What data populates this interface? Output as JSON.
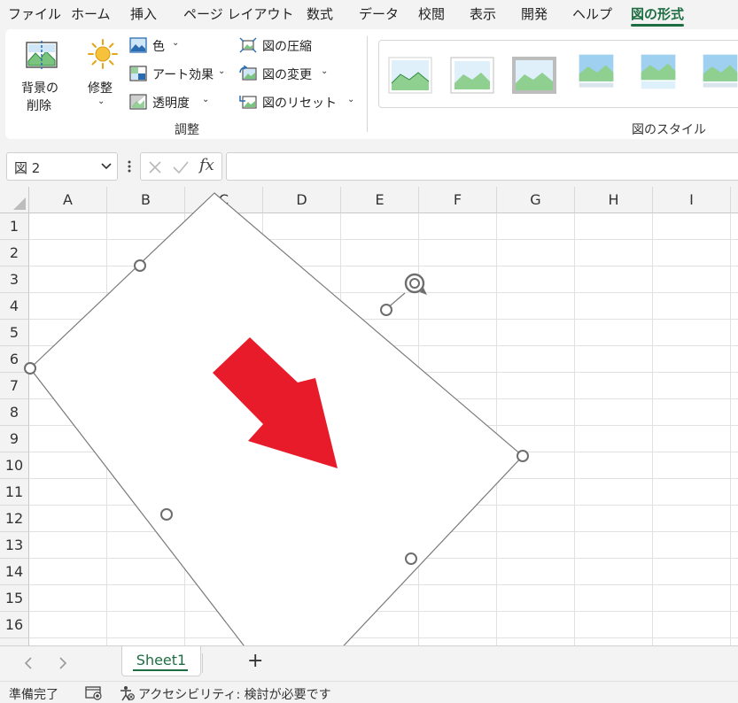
{
  "tabs": [
    {
      "label": "ファイル",
      "active": false
    },
    {
      "label": "ホーム",
      "active": false
    },
    {
      "label": "挿入",
      "active": false
    },
    {
      "label": "ページ レイアウト",
      "active": false
    },
    {
      "label": "数式",
      "active": false
    },
    {
      "label": "データ",
      "active": false
    },
    {
      "label": "校閲",
      "active": false
    },
    {
      "label": "表示",
      "active": false
    },
    {
      "label": "開発",
      "active": false
    },
    {
      "label": "ヘルプ",
      "active": false
    },
    {
      "label": "図の形式",
      "active": true
    }
  ],
  "ribbon": {
    "remove_background": {
      "line1": "背景の",
      "line2": "削除"
    },
    "corrections": "修整",
    "color": "色",
    "artistic_effects": "アート効果",
    "transparency": "透明度",
    "compress": "図の圧縮",
    "change_picture": "図の変更",
    "reset_picture": "図のリセット",
    "adjust_group": "調整",
    "styles_group": "図のスタイル"
  },
  "formula_bar": {
    "name_box": "図 2",
    "formula": ""
  },
  "grid": {
    "columns": [
      "A",
      "B",
      "C",
      "D",
      "E",
      "F",
      "G",
      "H",
      "I"
    ],
    "rows": [
      "1",
      "2",
      "3",
      "4",
      "5",
      "6",
      "7",
      "8",
      "9",
      "10",
      "11",
      "12",
      "13",
      "14",
      "15",
      "16"
    ]
  },
  "sheets": {
    "active": "Sheet1",
    "add_label": "+"
  },
  "status": {
    "ready": "準備完了",
    "accessibility": "アクセシビリティ: 検討が必要です"
  },
  "colors": {
    "accent": "#1f6e43",
    "arrow": "#e81b2b",
    "handle": "#6d6d6d"
  }
}
